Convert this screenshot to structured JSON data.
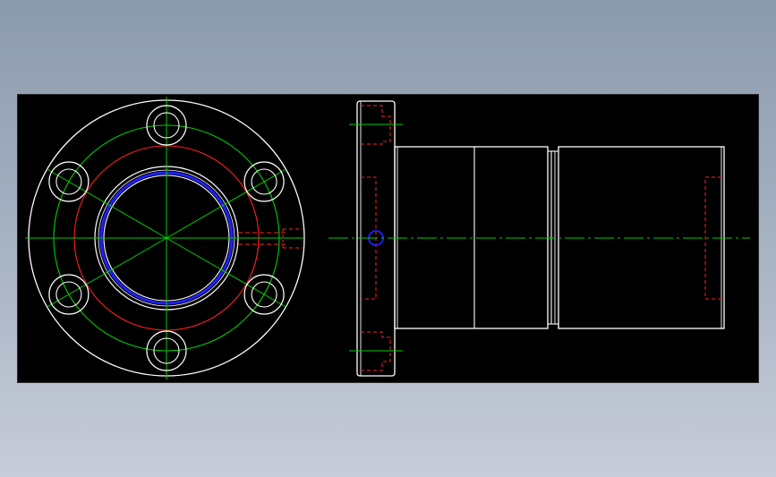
{
  "drawing": {
    "background": "#000000",
    "colors": {
      "outline": "#ffffff",
      "center": "#00cc00",
      "hidden": "#ff2020",
      "bore": "#2020ff"
    },
    "front_view": {
      "bolt_hole_count": 6,
      "bolt_angles_deg": [
        90,
        30,
        -30,
        -90,
        -150,
        150
      ],
      "radial_line_angles_deg": [
        90,
        30,
        -30,
        -90,
        -150,
        150
      ]
    },
    "side_view": {
      "segments": [
        "flange",
        "body-front",
        "body-mid",
        "groove",
        "body-rear"
      ]
    }
  }
}
